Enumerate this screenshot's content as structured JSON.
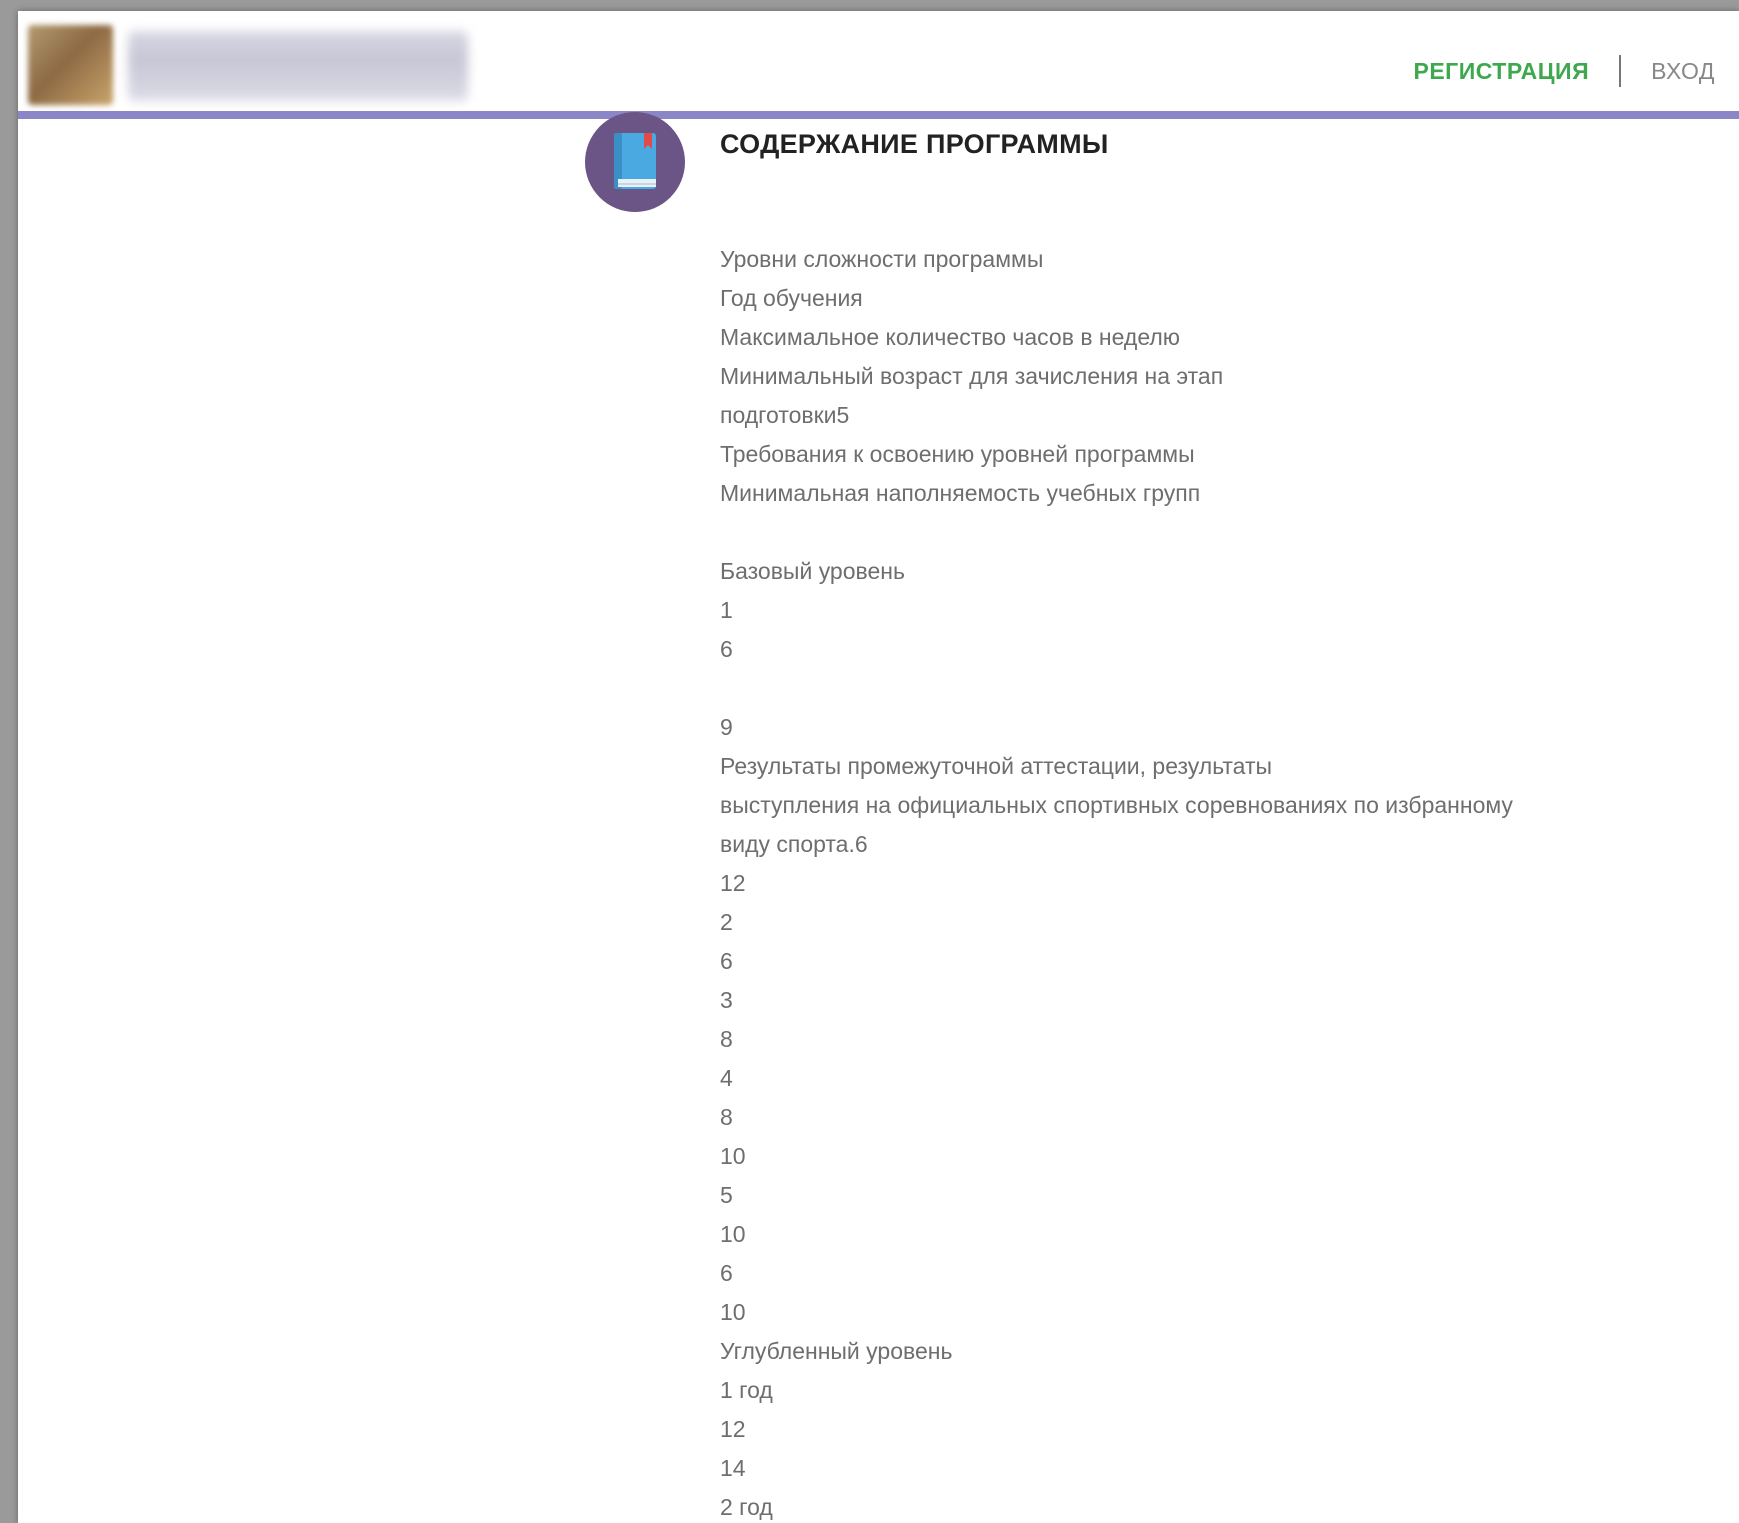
{
  "header": {
    "register_label": "РЕГИСТРАЦИЯ",
    "login_label": "ВХОД",
    "accent_color": "#3fa84e",
    "divider_color": "#8b86c5"
  },
  "section": {
    "icon": "book-icon",
    "title": "СОДЕРЖАНИЕ ПРОГРАММЫ",
    "lines": [
      "Уровни сложности программы",
      "Год обучения",
      "Максимальное количество часов в неделю",
      "Минимальный возраст для зачисления на этап",
      "подготовки5",
      "Требования к освоению уровней программы",
      "Минимальная наполняемость учебных групп",
      "",
      "Базовый уровень",
      "1",
      "6",
      "",
      "9",
      "Результаты промежуточной аттестации, результаты",
      "выступления на официальных спортивных соревнованиях по избранному",
      "виду спорта.6",
      "12",
      "2",
      "6",
      "3",
      "8",
      "4",
      "8",
      "10",
      "5",
      "10",
      "6",
      "10",
      "Углубленный уровень",
      "1 год",
      "12",
      "14",
      "2 год"
    ]
  }
}
